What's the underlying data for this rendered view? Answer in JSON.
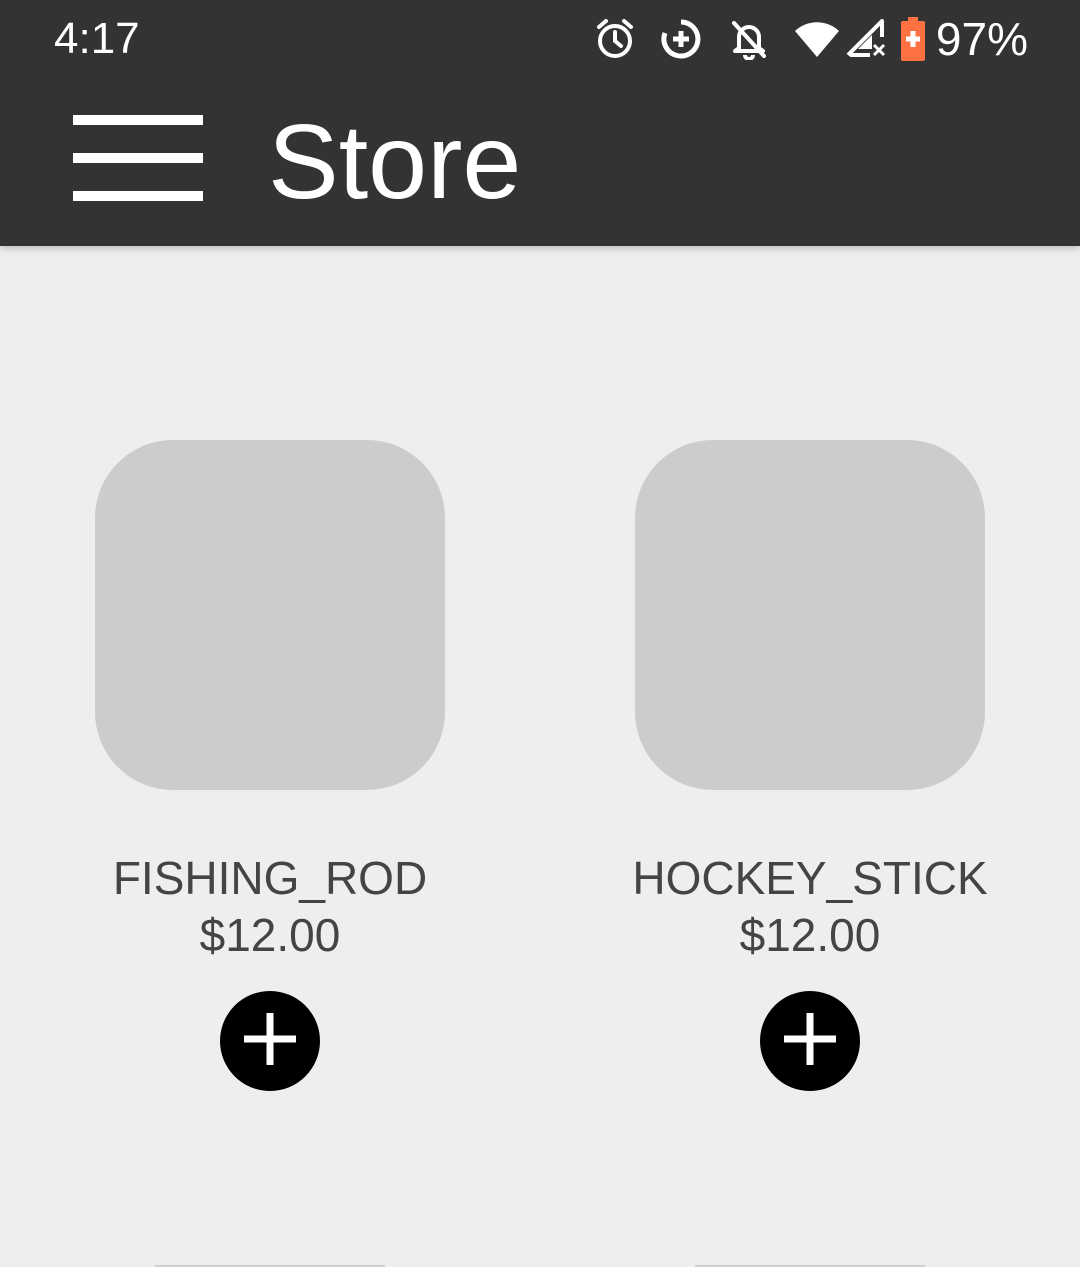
{
  "status_bar": {
    "time": "4:17",
    "icons": [
      "alarm-icon",
      "data-saver-icon",
      "notifications-off-icon",
      "wifi-icon",
      "cell-signal-icon",
      "battery-charging-icon"
    ],
    "battery_percent": "97%",
    "battery_color": "#ff7043"
  },
  "app_bar": {
    "title": "Store",
    "menu_icon": "hamburger-menu-icon",
    "background": "#333333"
  },
  "products": [
    {
      "name": "FISHING_ROD",
      "price": "$12.00",
      "action_icon": "add-circle-icon"
    },
    {
      "name": "HOCKEY_STICK",
      "price": "$12.00",
      "action_icon": "add-circle-icon"
    }
  ]
}
